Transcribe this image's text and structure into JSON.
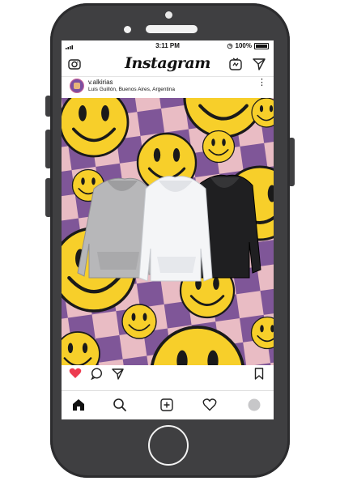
{
  "status_bar": {
    "time": "3:11 PM",
    "battery": "100%"
  },
  "app": {
    "title": "Instagram"
  },
  "post": {
    "username": "v.alkirias",
    "location": "Luis Guillón, Buenos Aires, Argentina",
    "options": "⋮"
  },
  "icons": {
    "camera": "camera-icon",
    "igtv": "igtv-icon",
    "direct": "paper-plane-icon",
    "like": "heart-icon",
    "comment": "comment-icon",
    "share": "share-icon",
    "save": "bookmark-icon",
    "home": "home-icon",
    "search": "search-icon",
    "add": "add-post-icon",
    "activity": "heart-outline-icon",
    "profile": "profile-icon"
  },
  "colors": {
    "like": "#ed3b50",
    "smiley": "#f7cf2a",
    "checker_purple": "#7f5698",
    "checker_pink": "#e9bcc4"
  }
}
